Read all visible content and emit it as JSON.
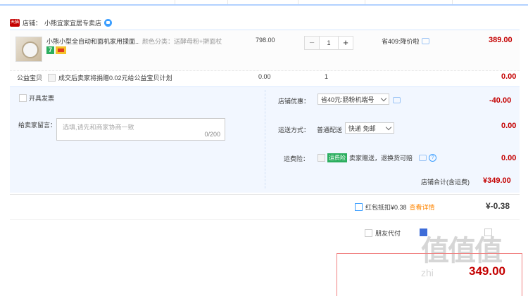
{
  "shop": {
    "label": "店铺：",
    "name": "小熊宜家宜居专卖店",
    "badge": "天猫"
  },
  "item": {
    "title": "小熊小型全自动和面机家用揉面...",
    "sku": "颜色分类：送酵母粉+擀面杖",
    "price": "798.00",
    "quantity": "1",
    "minus": "−",
    "plus": "+",
    "promo": "省409:降价啦",
    "subtotal": "389.00",
    "badge7": "7"
  },
  "charity": {
    "label": "公益宝贝",
    "desc": "成交后卖家将捐赠0.02元给公益宝贝计划",
    "price": "0.00",
    "qty": "1",
    "amount": "0.00"
  },
  "invoice": {
    "label": "开具发票"
  },
  "message": {
    "label": "给卖家留言：",
    "placeholder": "选填,请先和商家协商一致",
    "counter": "0/200"
  },
  "shop_discount": {
    "label": "店铺优惠：",
    "selected": "省40元:肠粉机端号",
    "amount": "-40.00"
  },
  "shipping": {
    "label": "运送方式：",
    "method": "普通配送",
    "selected": "快递 免邮",
    "amount": "0.00"
  },
  "insurance": {
    "label": "运费险：",
    "tag": "运费险",
    "desc": "卖家赠送，退换货可赔",
    "amount": "0.00",
    "help": "?"
  },
  "shop_total": {
    "label": "店铺合计(含运费)",
    "amount": "¥349.00"
  },
  "redpacket": {
    "label": "红包抵扣¥0.38",
    "link": "查看详情",
    "amount": "¥-0.38"
  },
  "options": {
    "friend_pay": "朋友代付"
  },
  "watermark": {
    "logo": "值值值",
    "url": "zhi"
  },
  "pay": {
    "amount": "349.00"
  }
}
